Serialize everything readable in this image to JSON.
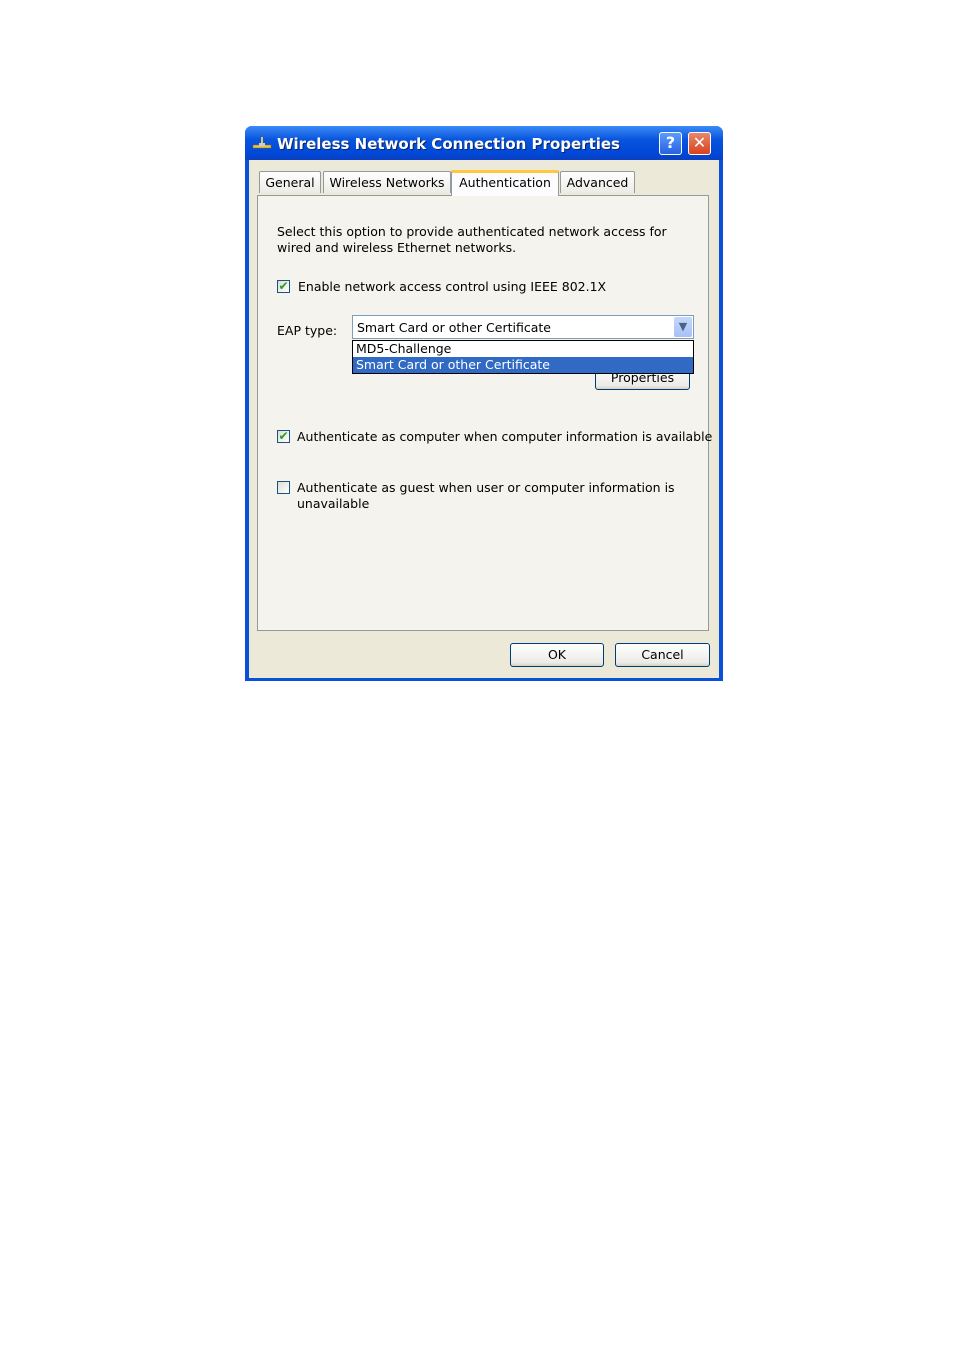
{
  "window": {
    "title": "Wireless Network Connection Properties",
    "help_label": "?",
    "close_label": "✕",
    "icon": "network-connection-icon"
  },
  "tabs": [
    {
      "label": "General"
    },
    {
      "label": "Wireless Networks"
    },
    {
      "label": "Authentication",
      "active": true
    },
    {
      "label": "Advanced"
    }
  ],
  "auth": {
    "description": "Select this option to provide authenticated network access for wired and wireless Ethernet networks.",
    "enable_8021x": {
      "label": "Enable network access control using IEEE 802.1X",
      "checked": true
    },
    "eap_label": "EAP type:",
    "eap_selected": "Smart Card or other Certificate",
    "eap_options": [
      "MD5-Challenge",
      "Smart Card or other Certificate"
    ],
    "properties_label": "Properties",
    "auth_computer": {
      "label": "Authenticate as computer when computer information is available",
      "checked": true
    },
    "auth_guest": {
      "label": "Authenticate as guest when user or computer information is unavailable",
      "checked": false
    }
  },
  "buttons": {
    "ok": "OK",
    "cancel": "Cancel"
  },
  "check_glyph": "✔"
}
